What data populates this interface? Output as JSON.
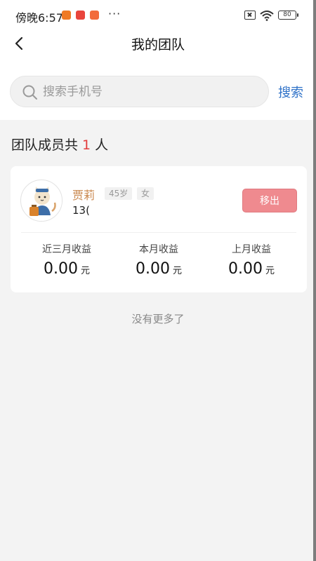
{
  "status_bar": {
    "time": "傍晚6:57",
    "more": "···",
    "battery": "80"
  },
  "nav": {
    "title": "我的团队"
  },
  "search": {
    "placeholder": "搜索手机号",
    "button_label": "搜索"
  },
  "team": {
    "summary_prefix": "团队成员共",
    "count": "1",
    "summary_suffix": "人"
  },
  "members": [
    {
      "name": "贾莉",
      "age": "45岁",
      "gender": "女",
      "phone": "13(",
      "remove_label": "移出",
      "stats": [
        {
          "label": "近三月收益",
          "value": "0.00",
          "unit": "元"
        },
        {
          "label": "本月收益",
          "value": "0.00",
          "unit": "元"
        },
        {
          "label": "上月收益",
          "value": "0.00",
          "unit": "元"
        }
      ]
    }
  ],
  "footer": {
    "no_more": "没有更多了"
  },
  "colors": {
    "accent_blue": "#2f72c8",
    "count_red": "#e23b3b",
    "name_orange": "#c9874d",
    "remove_pink": "#ef8a8f"
  },
  "icons": [
    "back-arrow-icon",
    "search-icon",
    "wifi-icon",
    "battery-icon",
    "sim-off-icon"
  ]
}
